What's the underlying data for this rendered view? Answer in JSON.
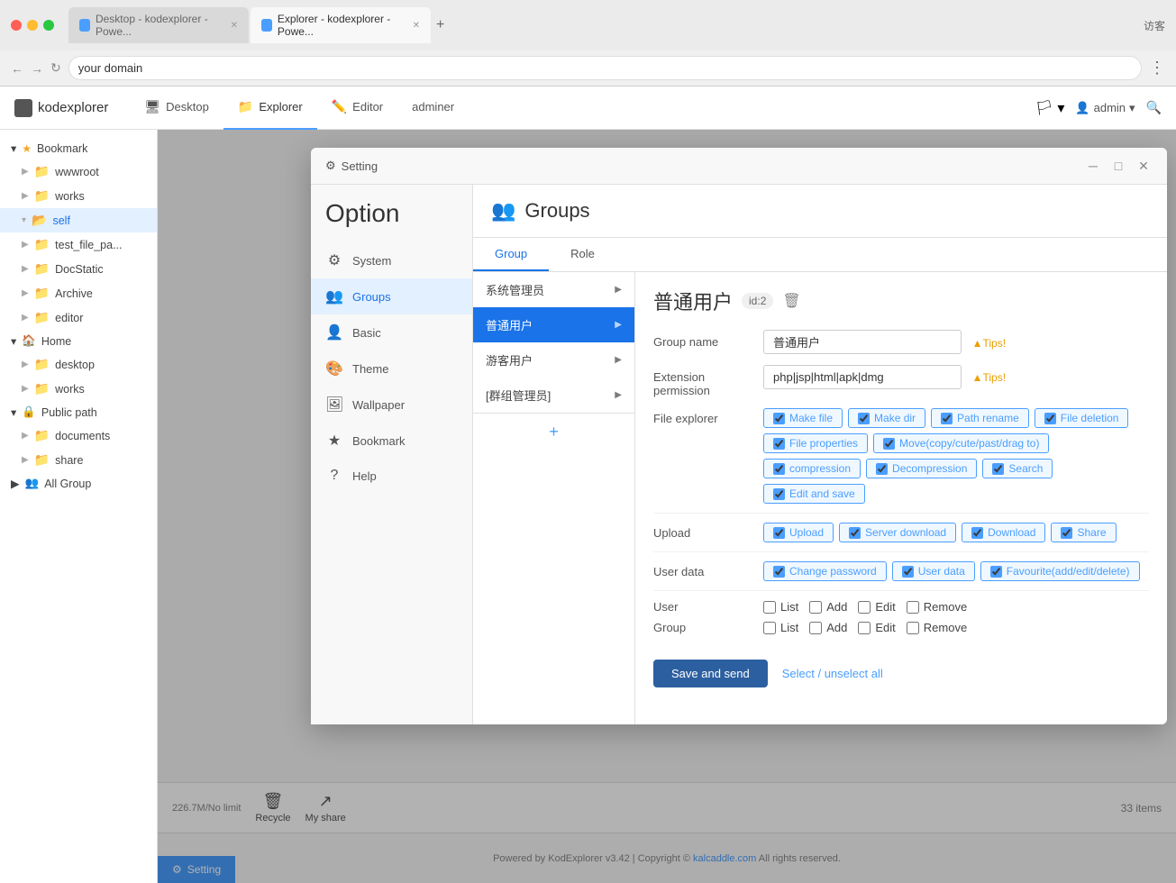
{
  "browser": {
    "tabs": [
      {
        "id": "tab1",
        "label": "Desktop - kodexplorer - Powe...",
        "active": false
      },
      {
        "id": "tab2",
        "label": "Explorer - kodexplorer - Powe...",
        "active": true
      }
    ],
    "address": "your domain",
    "guest_label": "访客",
    "menu_icon": "⋮"
  },
  "appbar": {
    "logo": "kodexplorer",
    "nav_items": [
      {
        "id": "desktop",
        "label": "Desktop",
        "icon": "🖥"
      },
      {
        "id": "explorer",
        "label": "Explorer",
        "icon": "📁"
      },
      {
        "id": "editor",
        "label": "Editor",
        "icon": "✏️"
      },
      {
        "id": "adminer",
        "label": "adminer",
        "icon": ""
      }
    ],
    "admin_label": "admin"
  },
  "sidebar": {
    "bookmark_label": "Bookmark",
    "items_bookmark": [
      {
        "id": "wwwroot",
        "label": "wwwroot",
        "type": "folder"
      },
      {
        "id": "works",
        "label": "works",
        "type": "folder"
      },
      {
        "id": "self",
        "label": "self",
        "type": "folder",
        "active": true
      }
    ],
    "items_bookmark2": [
      {
        "id": "test_file_pa",
        "label": "test_file_pa...",
        "type": "folder"
      },
      {
        "id": "DocStatic",
        "label": "DocStatic",
        "type": "folder"
      },
      {
        "id": "Archive",
        "label": "Archive",
        "type": "folder"
      },
      {
        "id": "editor",
        "label": "editor",
        "type": "folder"
      }
    ],
    "home_label": "Home",
    "items_home": [
      {
        "id": "desktop_h",
        "label": "desktop",
        "type": "folder"
      },
      {
        "id": "works_h",
        "label": "works",
        "type": "folder"
      }
    ],
    "public_path_label": "Public path",
    "items_public": [
      {
        "id": "documents",
        "label": "documents",
        "type": "folder"
      },
      {
        "id": "share",
        "label": "share",
        "type": "folder"
      }
    ],
    "all_group_label": "All Group"
  },
  "bottom_bar": {
    "storage_info": "226.7M/No limit",
    "recycle_label": "Recycle",
    "my_share_label": "My share",
    "items_count": "33 items"
  },
  "footer": {
    "text": "Powered by KodExplorer v3.42 | Copyright ©",
    "link_label": "kalcaddle.com",
    "rights": "All rights reserved."
  },
  "taskbar": {
    "setting_label": "Setting"
  },
  "modal": {
    "title": "Setting",
    "option_label": "Option",
    "nav_items": [
      {
        "id": "system",
        "label": "System",
        "icon": "⚙"
      },
      {
        "id": "groups",
        "label": "Groups",
        "icon": "👥",
        "active": true
      },
      {
        "id": "basic",
        "label": "Basic",
        "icon": "👤"
      },
      {
        "id": "theme",
        "label": "Theme",
        "icon": "🎨"
      },
      {
        "id": "wallpaper",
        "label": "Wallpaper",
        "icon": "🖼"
      },
      {
        "id": "bookmark",
        "label": "Bookmark",
        "icon": "⭐"
      },
      {
        "id": "help",
        "label": "Help",
        "icon": "?"
      }
    ],
    "groups": {
      "title": "Groups",
      "tabs": [
        {
          "id": "group",
          "label": "Group",
          "active": true
        },
        {
          "id": "role",
          "label": "Role"
        }
      ],
      "group_list": [
        {
          "id": "sysadmin",
          "label": "系统管理员",
          "active": false
        },
        {
          "id": "normal",
          "label": "普通用户",
          "active": true
        },
        {
          "id": "guest",
          "label": "游客用户",
          "active": false
        },
        {
          "id": "group_mgr",
          "label": "[群组管理员]",
          "active": false
        }
      ],
      "detail": {
        "name_display": "普通用户",
        "id_display": "id:2",
        "group_name_label": "Group name",
        "group_name_value": "普通用户",
        "tips1": "▲Tips!",
        "extension_label": "Extension permission",
        "extension_value": "php|jsp|html|apk|dmg",
        "tips2": "▲Tips!",
        "file_explorer_label": "File explorer",
        "permissions_file": [
          {
            "id": "make_file",
            "label": "Make file",
            "checked": true
          },
          {
            "id": "make_dir",
            "label": "Make dir",
            "checked": true
          },
          {
            "id": "path_rename",
            "label": "Path rename",
            "checked": true
          },
          {
            "id": "file_deletion",
            "label": "File deletion",
            "checked": true
          },
          {
            "id": "file_properties",
            "label": "File properties",
            "checked": true
          },
          {
            "id": "move",
            "label": "Move(copy/cute/past/drag to)",
            "checked": true
          },
          {
            "id": "compression",
            "label": "compression",
            "checked": true
          },
          {
            "id": "decompression",
            "label": "Decompression",
            "checked": true
          },
          {
            "id": "search",
            "label": "Search",
            "checked": true
          },
          {
            "id": "edit_save",
            "label": "Edit and save",
            "checked": true
          }
        ],
        "upload_label": "Upload",
        "permissions_upload": [
          {
            "id": "upload",
            "label": "Upload",
            "checked": true
          },
          {
            "id": "server_download",
            "label": "Server download",
            "checked": true
          },
          {
            "id": "download",
            "label": "Download",
            "checked": true
          },
          {
            "id": "share",
            "label": "Share",
            "checked": true
          }
        ],
        "user_data_label": "User data",
        "permissions_userdata": [
          {
            "id": "change_pwd",
            "label": "Change password",
            "checked": true
          },
          {
            "id": "user_data",
            "label": "User data",
            "checked": true
          },
          {
            "id": "favourite",
            "label": "Favourite(add/edit/delete)",
            "checked": true
          }
        ],
        "user_label": "User",
        "user_perms": [
          {
            "id": "user_list",
            "label": "List",
            "checked": false
          },
          {
            "id": "user_add",
            "label": "Add",
            "checked": false
          },
          {
            "id": "user_edit",
            "label": "Edit",
            "checked": false
          },
          {
            "id": "user_remove",
            "label": "Remove",
            "checked": false
          }
        ],
        "group_label": "Group",
        "group_perms": [
          {
            "id": "group_list",
            "label": "List",
            "checked": false
          },
          {
            "id": "group_add",
            "label": "Add",
            "checked": false
          },
          {
            "id": "group_edit",
            "label": "Edit",
            "checked": false
          },
          {
            "id": "group_remove",
            "label": "Remove",
            "checked": false
          }
        ],
        "save_btn_label": "Save and send",
        "select_all_label": "Select / unselect all"
      }
    }
  }
}
